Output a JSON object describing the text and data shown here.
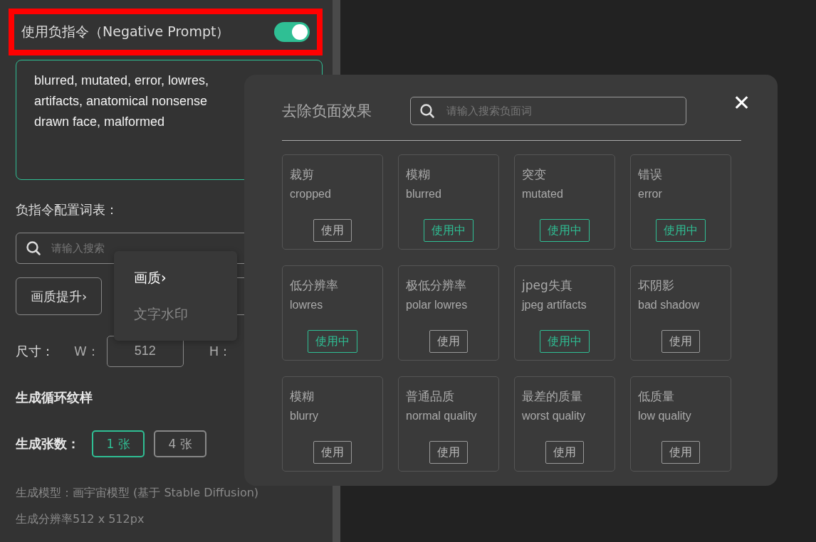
{
  "panel": {
    "header": {
      "title": "使用负指令（Negative Prompt）",
      "on": true,
      "highlighted": true
    },
    "prompt_lines": [
      "blurred, mutated, error, lowres,",
      "artifacts, anatomical nonsense",
      "drawn face, malformed"
    ],
    "word_list_label": "负指令配置词表：",
    "search": {
      "placeholder": "请输入搜索"
    },
    "categories": [
      {
        "label": "画质提升",
        "chevron": "›"
      }
    ],
    "size": {
      "label": "尺寸：",
      "w_label": "W：",
      "w_value": "512",
      "h_label": "H："
    },
    "loop_pattern": "生成循环纹样",
    "count": {
      "label": "生成张数：",
      "options": [
        {
          "label": "1 张",
          "selected": true
        },
        {
          "label": "4 张",
          "selected": false
        }
      ]
    },
    "model_info": "生成模型：画宇宙模型 (基于 Stable Diffusion)",
    "resolution_info": "生成分辨率512 x 512px"
  },
  "dropdown": {
    "items": [
      {
        "label": "画质",
        "chevron": "›",
        "selected": true
      },
      {
        "label": "文字水印",
        "selected": false
      }
    ]
  },
  "modal": {
    "title": "去除负面效果",
    "search": {
      "placeholder": "请输入搜索负面词"
    },
    "close": "✕",
    "cards": [
      {
        "cn": "裁剪",
        "en": "cropped",
        "button": "使用",
        "in_use": false
      },
      {
        "cn": "模糊",
        "en": "blurred",
        "button": "使用中",
        "in_use": true
      },
      {
        "cn": "突变",
        "en": "mutated",
        "button": "使用中",
        "in_use": true
      },
      {
        "cn": "错误",
        "en": "error",
        "button": "使用中",
        "in_use": true
      },
      {
        "cn": "低分辨率",
        "en": "lowres",
        "button": "使用中",
        "in_use": true
      },
      {
        "cn": "极低分辨率",
        "en": "polar lowres",
        "button": "使用",
        "in_use": false
      },
      {
        "cn": "jpeg失真",
        "en": "jpeg artifacts",
        "button": "使用中",
        "in_use": true
      },
      {
        "cn": "坏阴影",
        "en": "bad shadow",
        "button": "使用",
        "in_use": false
      },
      {
        "cn": "模糊",
        "en": "blurry",
        "button": "使用",
        "in_use": false
      },
      {
        "cn": "普通品质",
        "en": "normal quality",
        "button": "使用",
        "in_use": false
      },
      {
        "cn": "最差的质量",
        "en": "worst quality",
        "button": "使用",
        "in_use": false
      },
      {
        "cn": "低质量",
        "en": "low quality",
        "button": "使用",
        "in_use": false
      }
    ]
  }
}
